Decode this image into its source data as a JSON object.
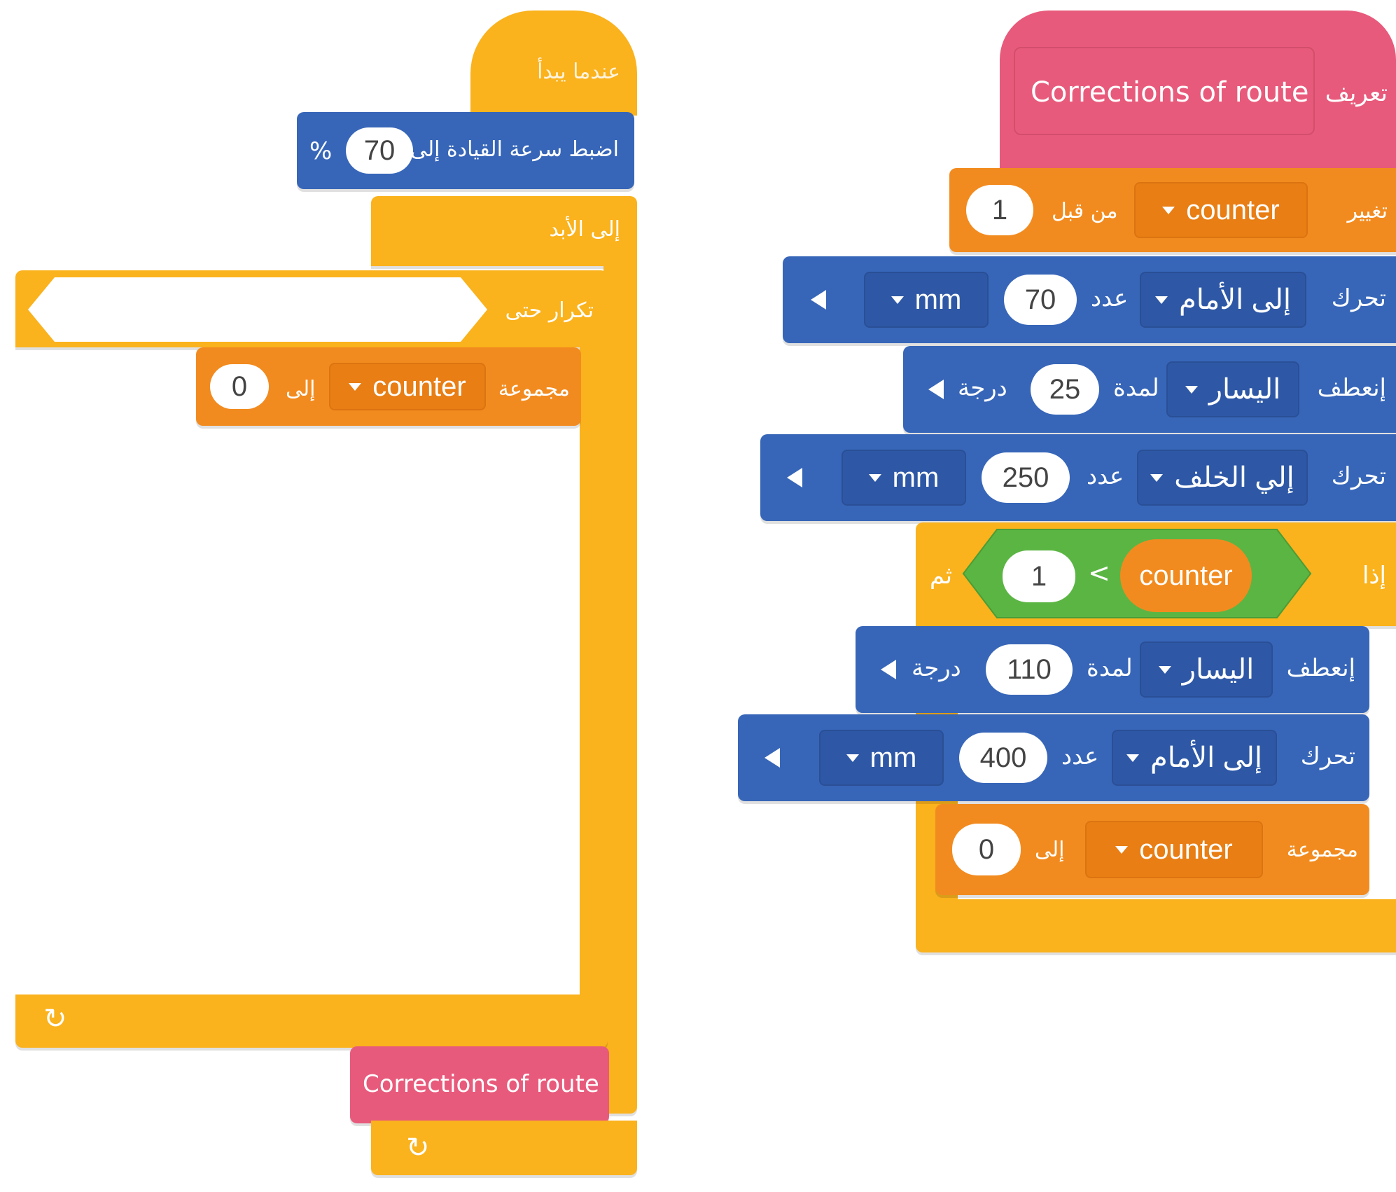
{
  "left_script": {
    "hat_label": "عندما يبدأ",
    "set_speed": {
      "label": "اضبط سرعة القيادة إلى",
      "value": "70",
      "unit": "%"
    },
    "forever_label": "إلى الأبد",
    "repeat_until_label": "تكرار حتى",
    "set_var": {
      "label": "مجموعة",
      "variable": "counter",
      "to_label": "إلى",
      "value": "0"
    },
    "call_block": "Corrections of route",
    "loop_arrow": "↻"
  },
  "right_script": {
    "define_label": "تعريف",
    "define_name": "Corrections of route",
    "change_var": {
      "label": "تغيير",
      "variable": "counter",
      "by_label": "من قبل",
      "value": "1"
    },
    "move1": {
      "label": "تحرك",
      "direction": "إلى الأمام",
      "count_label": "عدد",
      "value": "70",
      "unit": "mm"
    },
    "turn1": {
      "label": "إنعطف",
      "direction": "اليسار",
      "for_label": "لمدة",
      "value": "25",
      "unit": "درجة"
    },
    "move2": {
      "label": "تحرك",
      "direction": "إلي الخلف",
      "count_label": "عدد",
      "value": "250",
      "unit": "mm"
    },
    "if_block": {
      "if_label": "إذا",
      "then_label": "ثم",
      "left": "1",
      "op": "<",
      "right": "counter"
    },
    "turn2": {
      "label": "إنعطف",
      "direction": "اليسار",
      "for_label": "لمدة",
      "value": "110",
      "unit": "درجة"
    },
    "move3": {
      "label": "تحرك",
      "direction": "إلى الأمام",
      "count_label": "عدد",
      "value": "400",
      "unit": "mm"
    },
    "set_var": {
      "label": "مجموعة",
      "variable": "counter",
      "to_label": "إلى",
      "value": "0"
    }
  },
  "colors": {
    "events": "#fab21d",
    "variables": "#f28b1f",
    "motion": "#3766b8",
    "myblocks": "#e85a7b",
    "operators": "#5bb543"
  }
}
